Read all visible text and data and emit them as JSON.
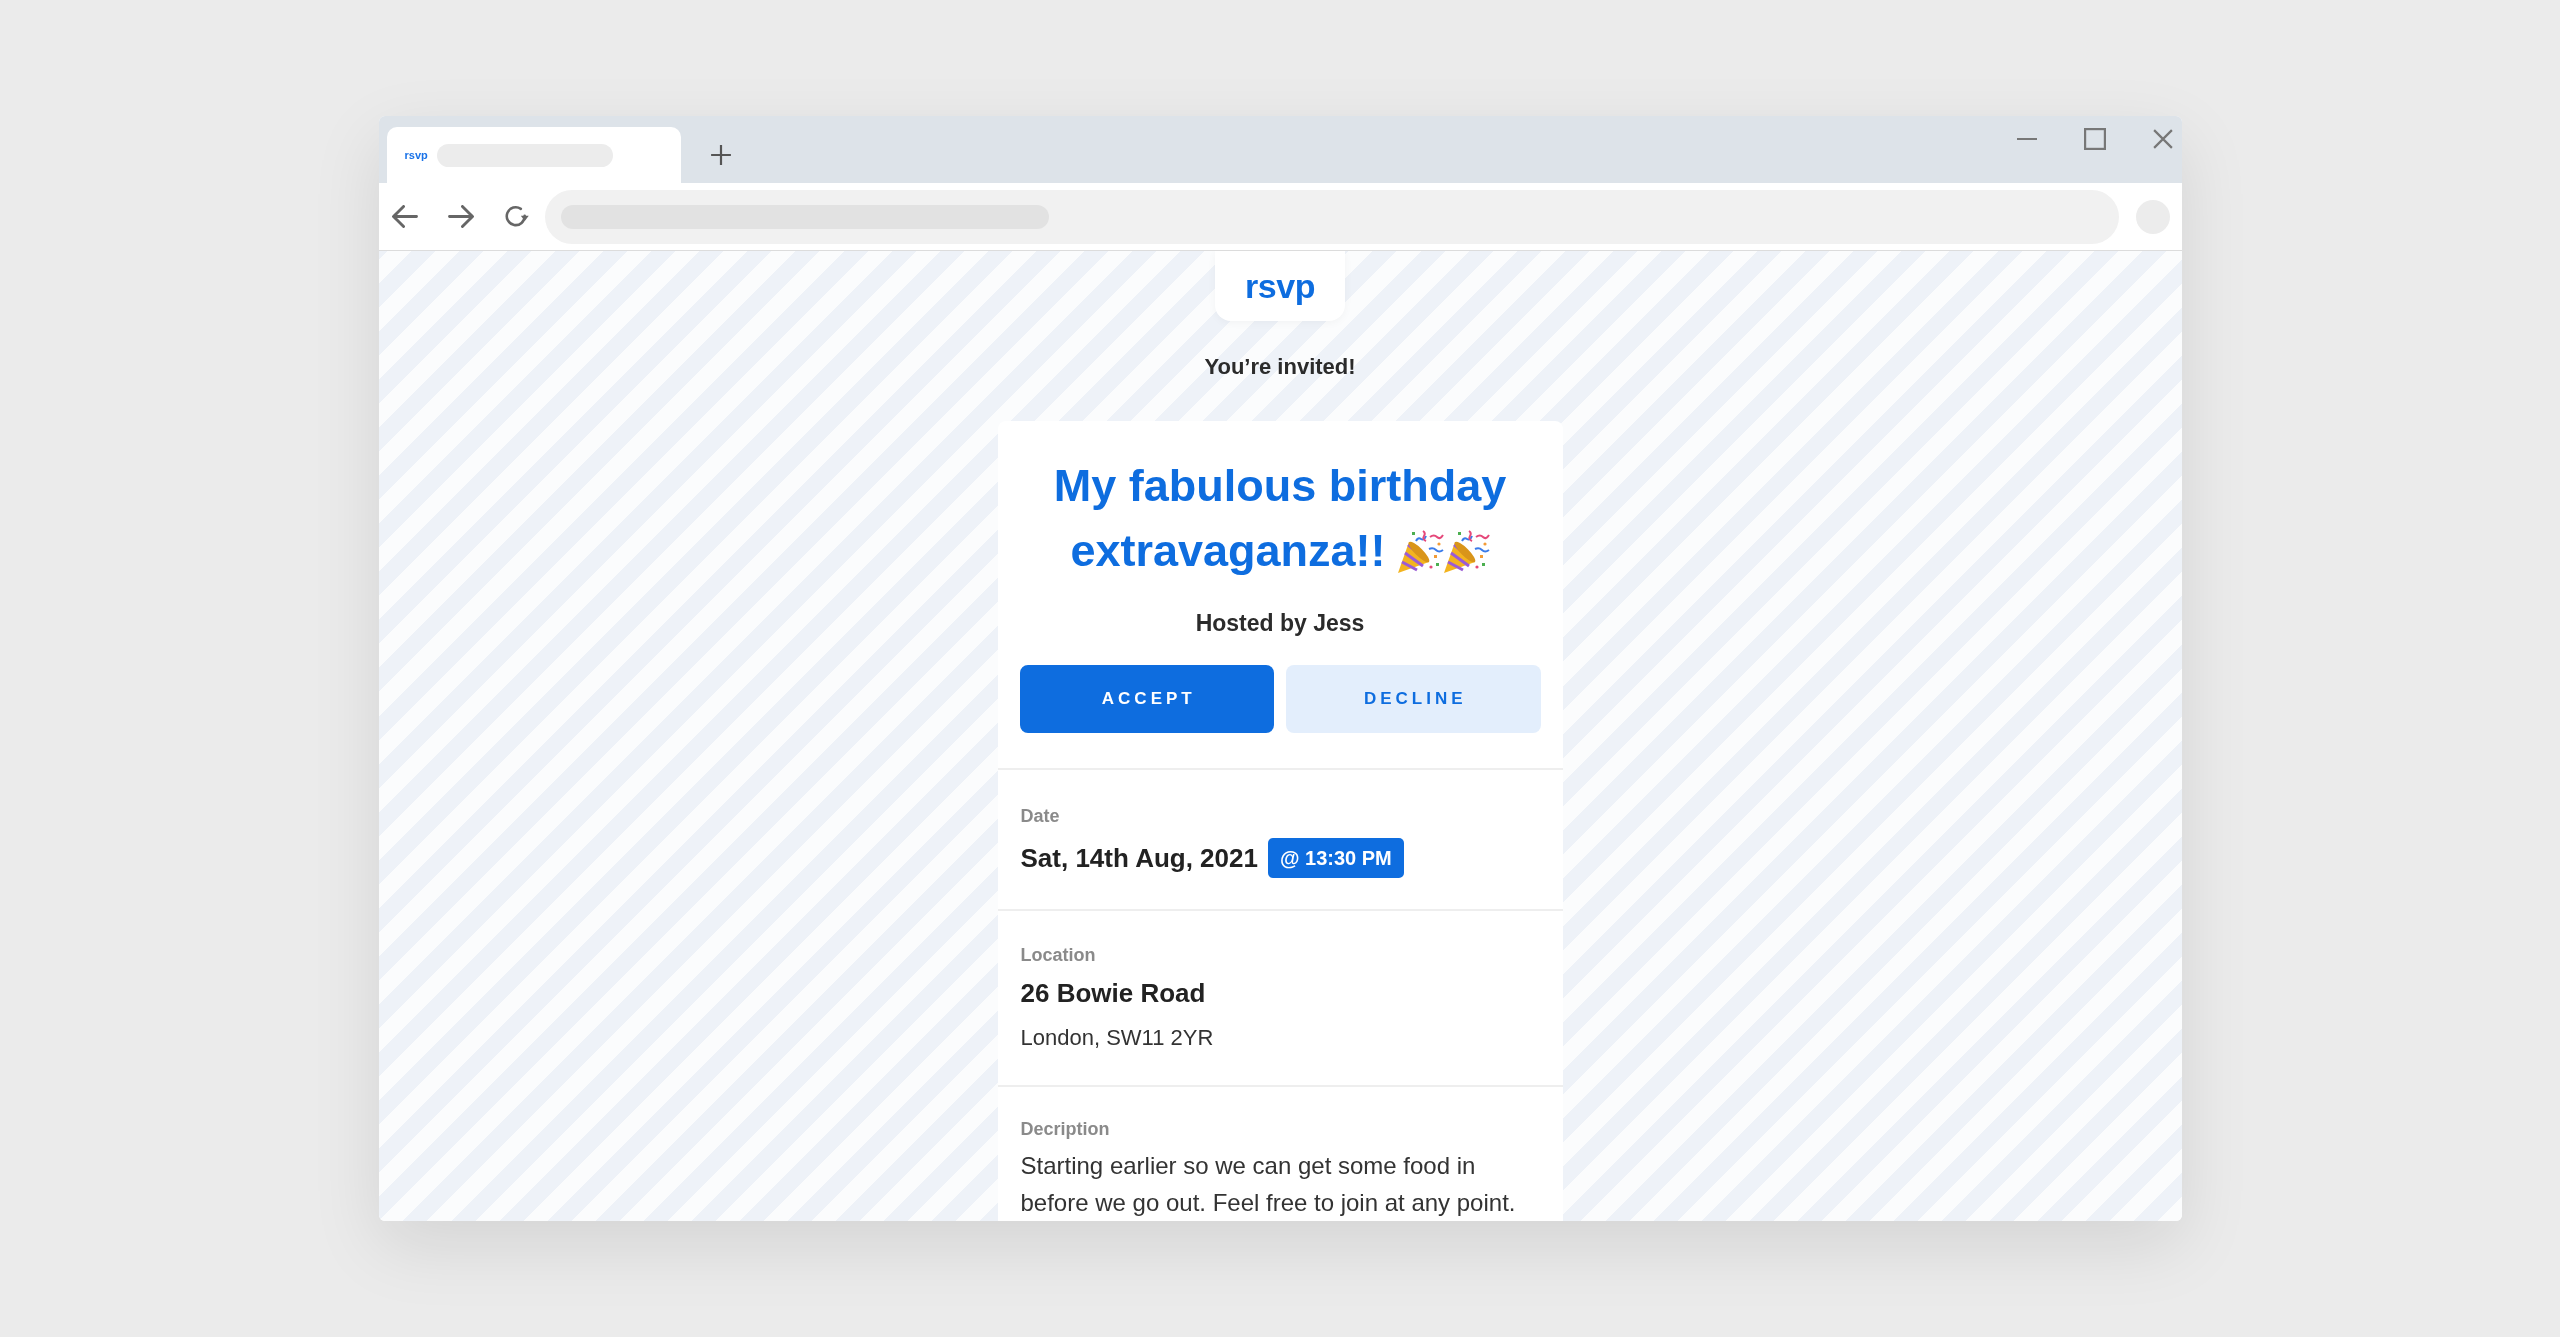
{
  "browser": {
    "tabs": [
      {
        "icon_text": "rsvp",
        "selected": true
      }
    ]
  },
  "page": {
    "logo": "rsvp",
    "heading": "You’re invited!",
    "event_card": {
      "title_lines": [
        "My fabulous birthday",
        "extravaganza!!"
      ],
      "host": "Hosted by Jess",
      "buttons": [
        {
          "label": "ACCEPT",
          "kind": "primary"
        },
        {
          "label": "DECLINE",
          "kind": "secondary"
        }
      ],
      "sections": [
        {
          "kind": "datetime",
          "label": "Date",
          "value": "Sat, 14th Aug, 2021",
          "badge": "@ 13:30 PM"
        },
        {
          "kind": "address",
          "label": "Location",
          "value": "26 Bowie Road",
          "detail": "London, SW11 2YR"
        },
        {
          "kind": "text",
          "label": "Decription",
          "text": "Starting earlier so we can get some food in before we go out. Feel free to join at any point."
        }
      ]
    }
  }
}
